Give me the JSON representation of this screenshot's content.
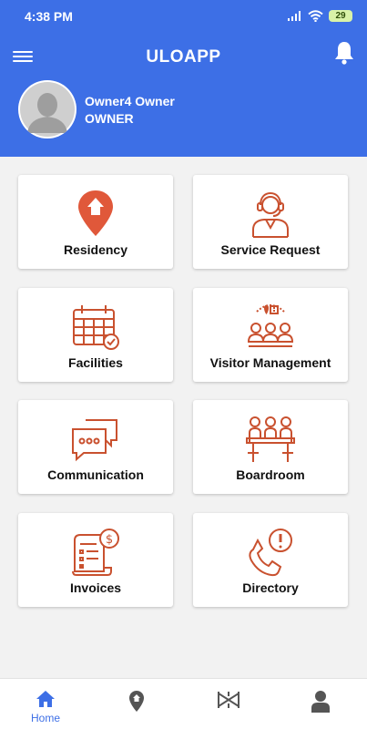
{
  "status_bar": {
    "time": "4:38 PM",
    "battery": "29"
  },
  "header": {
    "title": "ULOAPP"
  },
  "profile": {
    "name": "Owner4  Owner",
    "role": "OWNER"
  },
  "tiles": [
    {
      "label": "Residency",
      "icon": "location-home-icon"
    },
    {
      "label": "Service Request",
      "icon": "support-agent-icon"
    },
    {
      "label": "Facilities",
      "icon": "calendar-check-icon"
    },
    {
      "label": "Visitor Management",
      "icon": "visitors-icon"
    },
    {
      "label": "Communication",
      "icon": "chat-bubbles-icon"
    },
    {
      "label": "Boardroom",
      "icon": "meeting-icon"
    },
    {
      "label": "Invoices",
      "icon": "invoice-icon"
    },
    {
      "label": "Directory",
      "icon": "phone-alert-icon"
    }
  ],
  "bottom_nav": {
    "home_label": "Home"
  },
  "colors": {
    "primary": "#3d6fe6",
    "accent": "#e0583a",
    "background": "#f2f2f2"
  }
}
